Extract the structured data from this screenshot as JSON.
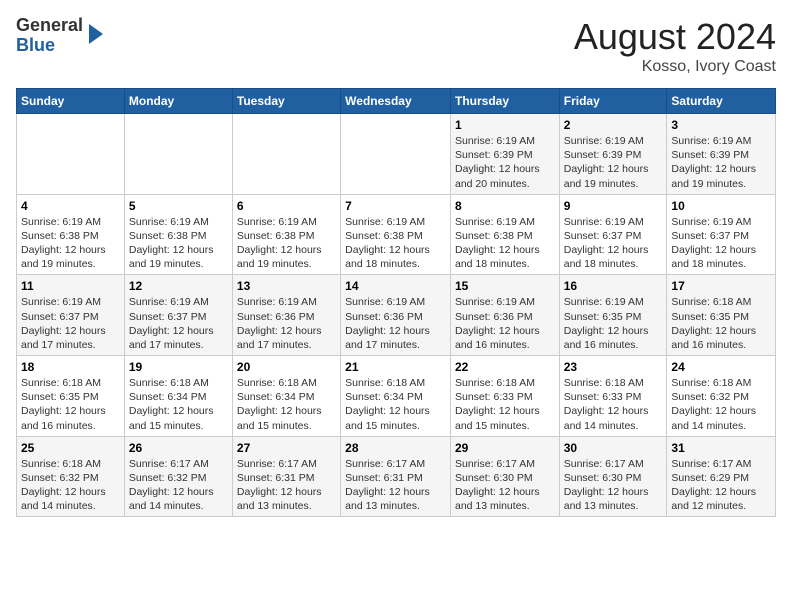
{
  "logo": {
    "line1": "General",
    "line2": "Blue"
  },
  "title": "August 2024",
  "subtitle": "Kosso, Ivory Coast",
  "days_of_week": [
    "Sunday",
    "Monday",
    "Tuesday",
    "Wednesday",
    "Thursday",
    "Friday",
    "Saturday"
  ],
  "weeks": [
    [
      {
        "day": "",
        "info": ""
      },
      {
        "day": "",
        "info": ""
      },
      {
        "day": "",
        "info": ""
      },
      {
        "day": "",
        "info": ""
      },
      {
        "day": "1",
        "info": "Sunrise: 6:19 AM\nSunset: 6:39 PM\nDaylight: 12 hours and 20 minutes."
      },
      {
        "day": "2",
        "info": "Sunrise: 6:19 AM\nSunset: 6:39 PM\nDaylight: 12 hours and 19 minutes."
      },
      {
        "day": "3",
        "info": "Sunrise: 6:19 AM\nSunset: 6:39 PM\nDaylight: 12 hours and 19 minutes."
      }
    ],
    [
      {
        "day": "4",
        "info": "Sunrise: 6:19 AM\nSunset: 6:38 PM\nDaylight: 12 hours and 19 minutes."
      },
      {
        "day": "5",
        "info": "Sunrise: 6:19 AM\nSunset: 6:38 PM\nDaylight: 12 hours and 19 minutes."
      },
      {
        "day": "6",
        "info": "Sunrise: 6:19 AM\nSunset: 6:38 PM\nDaylight: 12 hours and 19 minutes."
      },
      {
        "day": "7",
        "info": "Sunrise: 6:19 AM\nSunset: 6:38 PM\nDaylight: 12 hours and 18 minutes."
      },
      {
        "day": "8",
        "info": "Sunrise: 6:19 AM\nSunset: 6:38 PM\nDaylight: 12 hours and 18 minutes."
      },
      {
        "day": "9",
        "info": "Sunrise: 6:19 AM\nSunset: 6:37 PM\nDaylight: 12 hours and 18 minutes."
      },
      {
        "day": "10",
        "info": "Sunrise: 6:19 AM\nSunset: 6:37 PM\nDaylight: 12 hours and 18 minutes."
      }
    ],
    [
      {
        "day": "11",
        "info": "Sunrise: 6:19 AM\nSunset: 6:37 PM\nDaylight: 12 hours and 17 minutes."
      },
      {
        "day": "12",
        "info": "Sunrise: 6:19 AM\nSunset: 6:37 PM\nDaylight: 12 hours and 17 minutes."
      },
      {
        "day": "13",
        "info": "Sunrise: 6:19 AM\nSunset: 6:36 PM\nDaylight: 12 hours and 17 minutes."
      },
      {
        "day": "14",
        "info": "Sunrise: 6:19 AM\nSunset: 6:36 PM\nDaylight: 12 hours and 17 minutes."
      },
      {
        "day": "15",
        "info": "Sunrise: 6:19 AM\nSunset: 6:36 PM\nDaylight: 12 hours and 16 minutes."
      },
      {
        "day": "16",
        "info": "Sunrise: 6:19 AM\nSunset: 6:35 PM\nDaylight: 12 hours and 16 minutes."
      },
      {
        "day": "17",
        "info": "Sunrise: 6:18 AM\nSunset: 6:35 PM\nDaylight: 12 hours and 16 minutes."
      }
    ],
    [
      {
        "day": "18",
        "info": "Sunrise: 6:18 AM\nSunset: 6:35 PM\nDaylight: 12 hours and 16 minutes."
      },
      {
        "day": "19",
        "info": "Sunrise: 6:18 AM\nSunset: 6:34 PM\nDaylight: 12 hours and 15 minutes."
      },
      {
        "day": "20",
        "info": "Sunrise: 6:18 AM\nSunset: 6:34 PM\nDaylight: 12 hours and 15 minutes."
      },
      {
        "day": "21",
        "info": "Sunrise: 6:18 AM\nSunset: 6:34 PM\nDaylight: 12 hours and 15 minutes."
      },
      {
        "day": "22",
        "info": "Sunrise: 6:18 AM\nSunset: 6:33 PM\nDaylight: 12 hours and 15 minutes."
      },
      {
        "day": "23",
        "info": "Sunrise: 6:18 AM\nSunset: 6:33 PM\nDaylight: 12 hours and 14 minutes."
      },
      {
        "day": "24",
        "info": "Sunrise: 6:18 AM\nSunset: 6:32 PM\nDaylight: 12 hours and 14 minutes."
      }
    ],
    [
      {
        "day": "25",
        "info": "Sunrise: 6:18 AM\nSunset: 6:32 PM\nDaylight: 12 hours and 14 minutes."
      },
      {
        "day": "26",
        "info": "Sunrise: 6:17 AM\nSunset: 6:32 PM\nDaylight: 12 hours and 14 minutes."
      },
      {
        "day": "27",
        "info": "Sunrise: 6:17 AM\nSunset: 6:31 PM\nDaylight: 12 hours and 13 minutes."
      },
      {
        "day": "28",
        "info": "Sunrise: 6:17 AM\nSunset: 6:31 PM\nDaylight: 12 hours and 13 minutes."
      },
      {
        "day": "29",
        "info": "Sunrise: 6:17 AM\nSunset: 6:30 PM\nDaylight: 12 hours and 13 minutes."
      },
      {
        "day": "30",
        "info": "Sunrise: 6:17 AM\nSunset: 6:30 PM\nDaylight: 12 hours and 13 minutes."
      },
      {
        "day": "31",
        "info": "Sunrise: 6:17 AM\nSunset: 6:29 PM\nDaylight: 12 hours and 12 minutes."
      }
    ]
  ]
}
